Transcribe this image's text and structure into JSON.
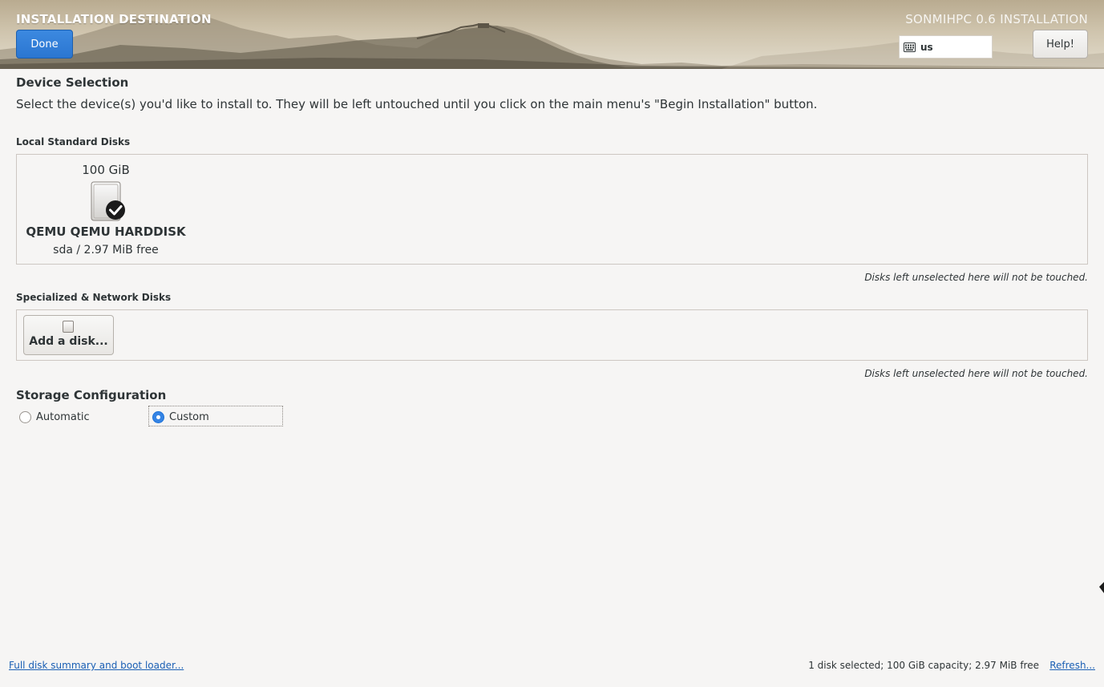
{
  "header": {
    "title": "INSTALLATION DESTINATION",
    "product": "SONMIHPC 0.6 INSTALLATION",
    "done_label": "Done",
    "keyboard_layout": "us",
    "help_label": "Help!"
  },
  "device_selection": {
    "heading": "Device Selection",
    "intro": "Select the device(s) you'd like to install to.  They will be left untouched until you click on the main menu's \"Begin Installation\" button."
  },
  "local_disks": {
    "label": "Local Standard Disks",
    "disks": [
      {
        "size": "100 GiB",
        "name": "QEMU QEMU HARDDISK",
        "detail": "sda   /   2.97 MiB free",
        "selected": true
      }
    ],
    "hint": "Disks left unselected here will not be touched."
  },
  "network_disks": {
    "label": "Specialized & Network Disks",
    "add_label": "Add a disk...",
    "hint": "Disks left unselected here will not be touched."
  },
  "storage_config": {
    "heading": "Storage Configuration",
    "options": [
      {
        "label": "Automatic",
        "selected": false
      },
      {
        "label": "Custom",
        "selected": true
      }
    ]
  },
  "footer": {
    "summary_link": "Full disk summary and boot loader...",
    "status": "1 disk selected; 100 GiB capacity; 2.97 MiB free",
    "refresh": "Refresh..."
  },
  "colors": {
    "accent": "#3584e4",
    "link": "#1a5fb4",
    "background": "#f6f5f4"
  }
}
